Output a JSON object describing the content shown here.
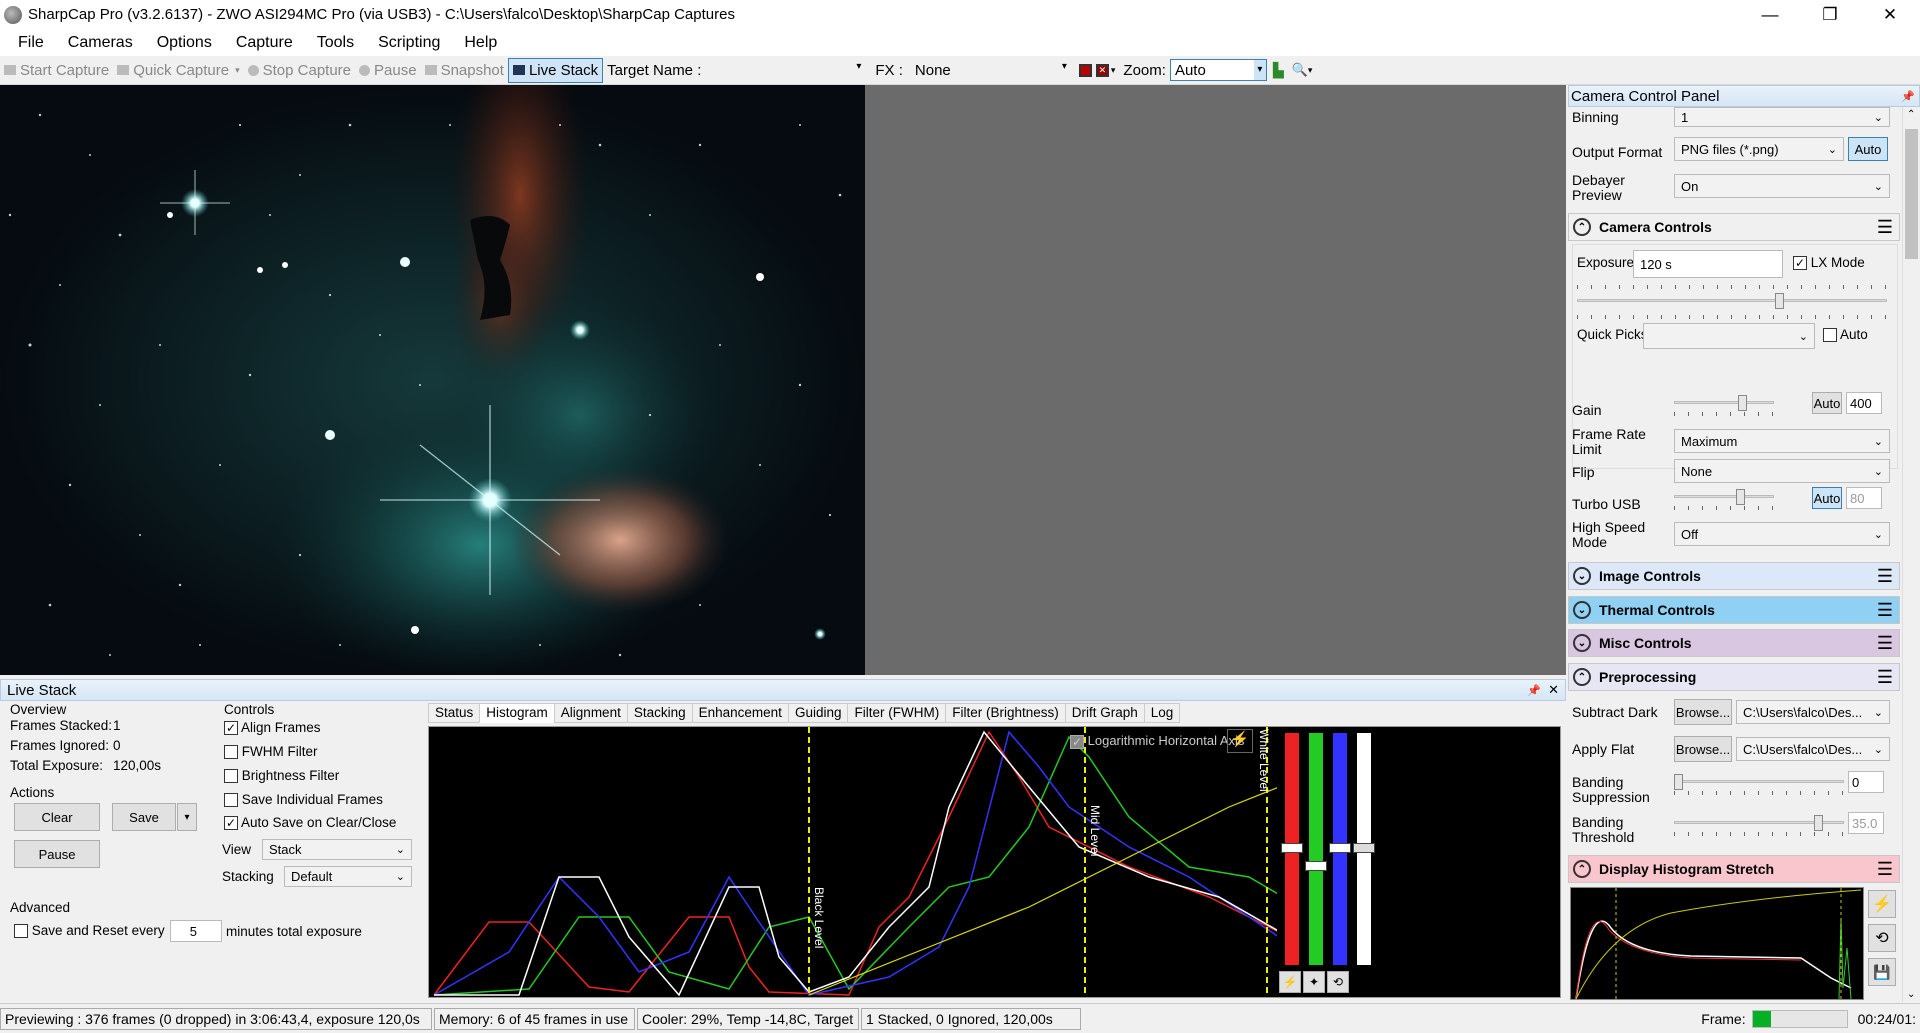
{
  "window": {
    "title": "SharpCap Pro (v3.2.6137) - ZWO ASI294MC Pro (via USB3) - C:\\Users\\falco\\Desktop\\SharpCap Captures",
    "minimize": "—",
    "restore": "❐",
    "close": "✕"
  },
  "menu": [
    "File",
    "Cameras",
    "Options",
    "Capture",
    "Tools",
    "Scripting",
    "Help"
  ],
  "toolbar": {
    "start_capture": "Start Capture",
    "quick_capture": "Quick Capture",
    "stop_capture": "Stop Capture",
    "pause": "Pause",
    "snapshot": "Snapshot",
    "live_stack": "Live Stack",
    "target_name_label": "Target Name :",
    "target_name_value": "",
    "fx_label": "FX :",
    "fx_value": "None",
    "zoom_label": "Zoom:",
    "zoom_value": "Auto"
  },
  "camera_panel": {
    "title": "Camera Control Panel",
    "binning_label": "Binning",
    "binning_value": "1",
    "output_format_label": "Output Format",
    "output_format_value": "PNG files (*.png)",
    "output_auto": "Auto",
    "debayer_label": "Debayer Preview",
    "debayer_value": "On",
    "camera_controls": "Camera Controls",
    "exposure_label": "Exposure",
    "exposure_value": "120 s",
    "lx_mode_label": "LX Mode",
    "quick_picks_label": "Quick Picks",
    "quick_picks_value": "",
    "quick_auto": "Auto",
    "gain_label": "Gain",
    "gain_auto": "Auto",
    "gain_value": "400",
    "frame_rate_label": "Frame Rate Limit",
    "frame_rate_value": "Maximum",
    "flip_label": "Flip",
    "flip_value": "None",
    "turbo_label": "Turbo USB",
    "turbo_auto": "Auto",
    "turbo_value": "80",
    "high_speed_label": "High Speed Mode",
    "high_speed_value": "Off",
    "image_controls": "Image Controls",
    "thermal_controls": "Thermal Controls",
    "misc_controls": "Misc Controls",
    "preprocessing": "Preprocessing",
    "subtract_dark_label": "Subtract Dark",
    "browse": "Browse...",
    "subtract_dark_value": "C:\\Users\\falco\\Des...",
    "apply_flat_label": "Apply Flat",
    "apply_flat_value": "C:\\Users\\falco\\Des...",
    "banding_supp_label": "Banding Suppression",
    "banding_supp_value": "0",
    "banding_thresh_label": "Banding Threshold",
    "banding_thresh_value": "35.0",
    "display_stretch": "Display Histogram Stretch",
    "colors": {
      "camera": "#fbe7d2",
      "image": "#dce8f8",
      "thermal": "#8fd0f3",
      "misc": "#d9c6e0",
      "pre": "#e6e6f5",
      "stretch": "#f8c6cc"
    }
  },
  "live_stack": {
    "title": "Live Stack",
    "overview": "Overview",
    "frames_stacked_label": "Frames Stacked:",
    "frames_stacked": "1",
    "frames_ignored_label": "Frames Ignored:",
    "frames_ignored": "0",
    "total_exposure_label": "Total Exposure:",
    "total_exposure": "120,00s",
    "actions": "Actions",
    "clear": "Clear",
    "save": "Save",
    "pause": "Pause",
    "controls": "Controls",
    "align_frames": "Align Frames",
    "fwhm_filter": "FWHM Filter",
    "brightness_filter": "Brightness Filter",
    "save_individual": "Save Individual Frames",
    "auto_save": "Auto Save on Clear/Close",
    "view_label": "View",
    "view_value": "Stack",
    "stacking_label": "Stacking",
    "stacking_value": "Default",
    "advanced": "Advanced",
    "save_reset_label": "Save and Reset every",
    "save_reset_value": "5",
    "minutes_label": "minutes total exposure",
    "tabs": [
      "Status",
      "Histogram",
      "Alignment",
      "Stacking",
      "Enhancement",
      "Guiding",
      "Filter (FWHM)",
      "Filter (Brightness)",
      "Drift Graph",
      "Log"
    ],
    "log_axis_label": "Logarithmic Horizontal Axis",
    "black_level": "Black Level",
    "mid_level": "Mid Level",
    "white_level": "White Level"
  },
  "status": {
    "preview": "Previewing : 376 frames (0 dropped) in 3:06:43,4, exposure 120,0s",
    "memory": "Memory: 6 of 45 frames in use",
    "cooler": "Cooler: 29%, Temp -14,8C, Target",
    "stacked": "1 Stacked, 0 Ignored, 120,00s",
    "frame_label": "Frame:",
    "time": "00:24/01:"
  }
}
